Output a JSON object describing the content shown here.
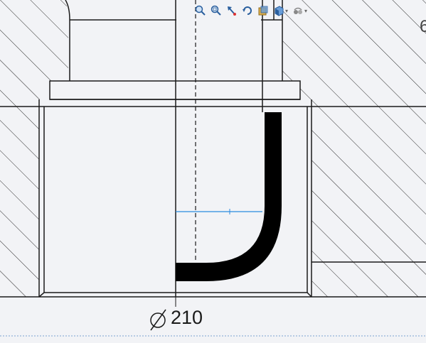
{
  "toolbar": {
    "buttons": [
      {
        "name": "zoom-to-fit-icon"
      },
      {
        "name": "zoom-to-area-icon"
      },
      {
        "name": "previous-view-icon"
      },
      {
        "name": "rotate-view-icon"
      },
      {
        "name": "section-view-icon"
      },
      {
        "name": "view-orientation-icon",
        "dropdown": true
      },
      {
        "name": "display-style-icon",
        "dropdown": true
      }
    ]
  },
  "dimension": {
    "symbol": "⌀",
    "value": "210"
  },
  "corner_label": "6",
  "colors": {
    "background": "#f2f3f6",
    "outline": "#1a1a1a",
    "hatch": "#2a2a2a",
    "dimension_line": "#2a8ae0",
    "curve_fill": "#000000"
  }
}
